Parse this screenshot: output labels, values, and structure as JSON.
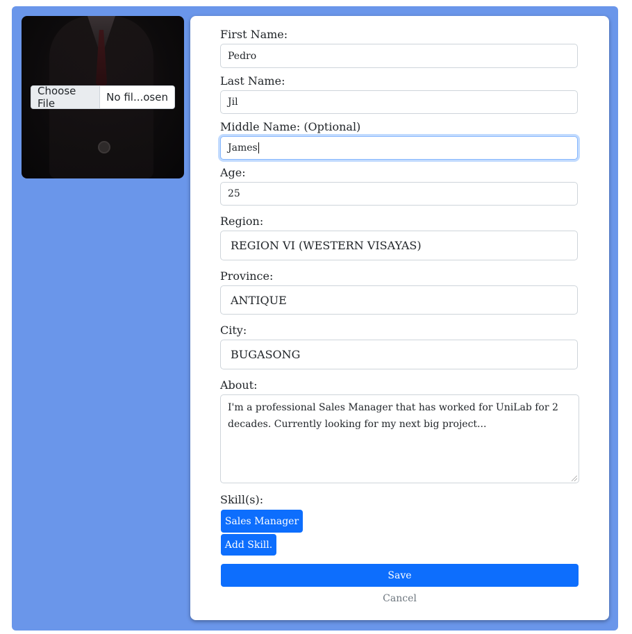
{
  "profile": {
    "file_input": {
      "button_label": "Choose File",
      "status": "No fil...osen"
    }
  },
  "form": {
    "first_name": {
      "label": "First Name:",
      "value": "Pedro"
    },
    "last_name": {
      "label": "Last Name:",
      "value": "Jil"
    },
    "middle_name": {
      "label": "Middle Name: (Optional)",
      "value": "James"
    },
    "age": {
      "label": "Age:",
      "value": "25"
    },
    "region": {
      "label": "Region:",
      "value": "REGION VI (WESTERN VISAYAS)"
    },
    "province": {
      "label": "Province:",
      "value": "ANTIQUE"
    },
    "city": {
      "label": "City:",
      "value": "BUGASONG"
    },
    "about": {
      "label": "About:",
      "value": "I'm a professional Sales Manager that has worked for UniLab for 2 decades. Currently looking for my next big project..."
    },
    "skills": {
      "label": "Skill(s):",
      "items": [
        "Sales Manager"
      ],
      "add_label": "Add Skill."
    },
    "save_label": "Save",
    "cancel_label": "Cancel"
  },
  "colors": {
    "background_panel": "#6a96ea",
    "primary_button": "#0d6efd",
    "focus_border": "#86b7fe"
  }
}
